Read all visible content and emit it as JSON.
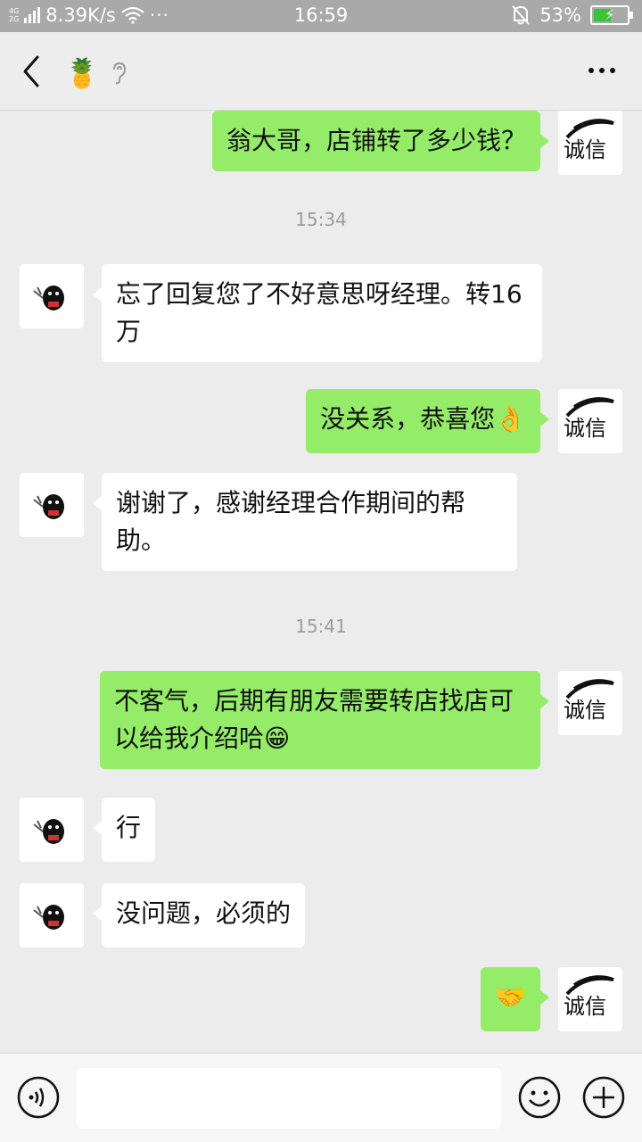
{
  "status_bar": {
    "net_type_top": "4G",
    "net_type_bottom": "2G",
    "speed": "8.39K/s",
    "more": "···",
    "time": "16:59",
    "battery": "53%",
    "battery_level": 0.53
  },
  "header": {
    "contact_avatar": "🍍"
  },
  "chat": {
    "messages": [
      {
        "from": "me",
        "text": "翁大哥，店铺转了多少钱？"
      },
      {
        "type": "timestamp",
        "text": "15:34"
      },
      {
        "from": "other",
        "text": "忘了回复您了不好意思呀经理。转16万"
      },
      {
        "from": "me",
        "text": "没关系，恭喜您",
        "emoji": "👌"
      },
      {
        "from": "other",
        "text": "谢谢了，感谢经理合作期间的帮助。"
      },
      {
        "type": "timestamp",
        "text": "15:41"
      },
      {
        "from": "me",
        "text": "不客气，后期有朋友需要转店找店可以给我介绍哈",
        "emoji": "😁"
      },
      {
        "from": "other",
        "text": "行"
      },
      {
        "from": "other",
        "text": "没问题，必须的"
      },
      {
        "from": "me",
        "text": "",
        "emoji": "🤝"
      }
    ],
    "my_avatar_text": "诚信"
  },
  "input_bar": {
    "input_value": "",
    "placeholder": ""
  },
  "colors": {
    "my_bubble": "#95ec69",
    "other_bubble": "#ffffff",
    "background": "#ececec"
  }
}
